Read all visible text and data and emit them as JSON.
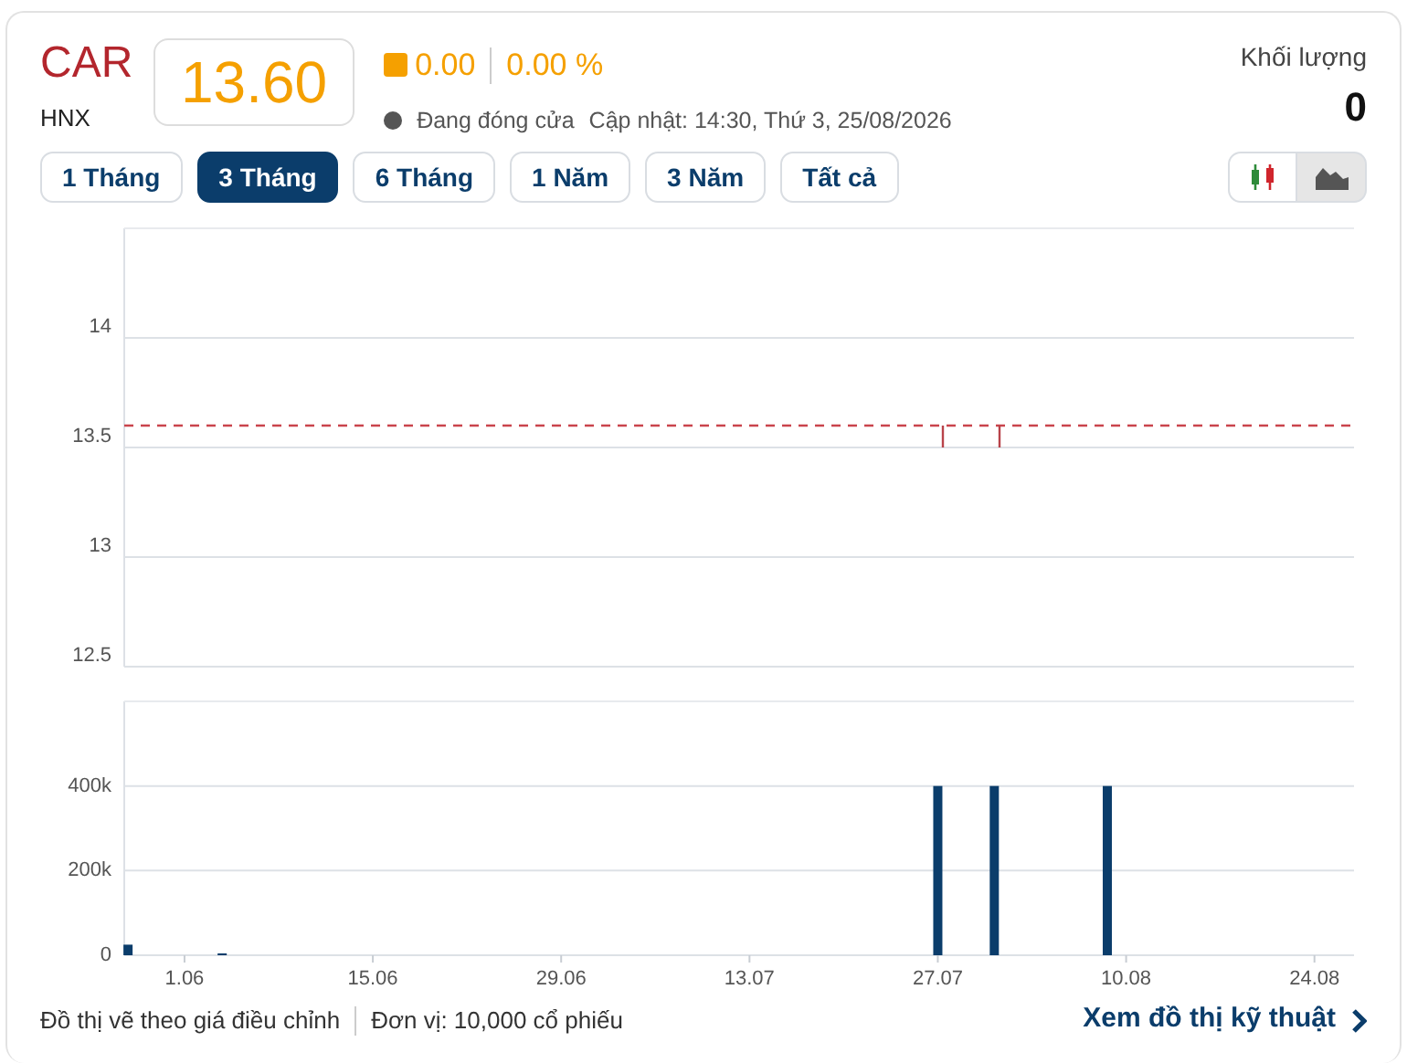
{
  "ticker": {
    "symbol": "CAR",
    "exchange": "HNX",
    "price": "13.60",
    "change": "0.00",
    "change_percent": "0.00 %",
    "status": "Đang đóng cửa",
    "updated": "Cập nhật: 14:30, Thứ 3, 25/08/2026"
  },
  "volume": {
    "label": "Khối lượng",
    "value": "0"
  },
  "ranges": [
    {
      "label": "1 Tháng",
      "selected": false
    },
    {
      "label": "3 Tháng",
      "selected": true
    },
    {
      "label": "6 Tháng",
      "selected": false
    },
    {
      "label": "1 Năm",
      "selected": false
    },
    {
      "label": "3 Năm",
      "selected": false
    },
    {
      "label": "Tất cả",
      "selected": false
    }
  ],
  "chart_types": [
    {
      "kind": "candle",
      "selected": false
    },
    {
      "kind": "area",
      "selected": true
    }
  ],
  "price_chart": {
    "y_labels": [
      "14",
      "13.5",
      "13",
      "12.5"
    ]
  },
  "volume_chart": {
    "y_labels": [
      "400k",
      "200k",
      "0"
    ],
    "x_labels": [
      "1.06",
      "15.06",
      "29.06",
      "13.07",
      "27.07",
      "10.08",
      "24.08"
    ]
  },
  "footer": {
    "note": "Đồ thị vẽ theo giá điều chỉnh",
    "unit": "Đơn vị: 10,000 cổ phiếu",
    "link": "Xem đồ thị kỹ thuật"
  }
}
